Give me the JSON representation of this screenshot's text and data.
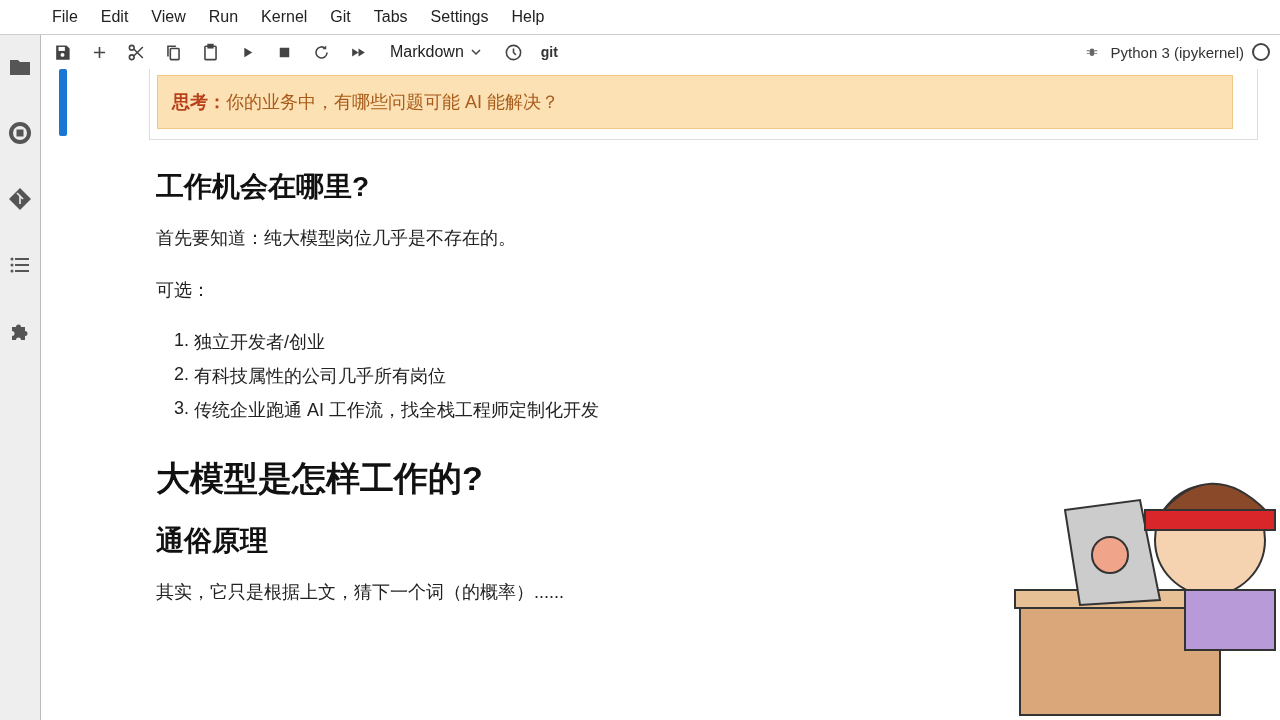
{
  "menu": [
    "File",
    "Edit",
    "View",
    "Run",
    "Kernel",
    "Git",
    "Tabs",
    "Settings",
    "Help"
  ],
  "toolbar": {
    "cell_type": "Markdown",
    "git": "git",
    "kernel": "Python 3 (ipykernel)",
    "kernel_busy": false
  },
  "cells": [
    {
      "selected": true,
      "blocks": [
        {
          "kind": "alert",
          "text": "**思考：**你的业务中，有哪些问题可能 AI 能解决？"
        }
      ]
    },
    {
      "selected": false,
      "blocks": [
        {
          "kind": "h2",
          "text": "工作机会在哪里?"
        },
        {
          "kind": "p",
          "text": "首先要知道：纯大模型岗位几乎是不存在的。"
        },
        {
          "kind": "p",
          "text": "可选："
        },
        {
          "kind": "ol",
          "items": [
            {
              "number": "1.",
              "text": "独立开发者/创业"
            },
            {
              "number": "2.",
              "text": "有科技属性的公司几乎所有岗位"
            },
            {
              "number": "3.",
              "text": "传统企业跑通 AI 工作流，找全栈工程师定制化开发"
            }
          ]
        },
        {
          "kind": "h1",
          "text": "大模型是怎样工作的?"
        },
        {
          "kind": "h2",
          "text": "通俗原理"
        },
        {
          "kind": "p",
          "text": "其实，它只是根据上文，猜下一个词（的概率）......"
        }
      ]
    }
  ]
}
